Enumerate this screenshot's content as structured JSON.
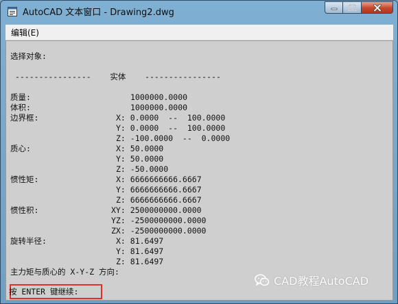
{
  "window": {
    "title": "AutoCAD 文本窗口 - Drawing2.dwg",
    "icons": {
      "app": "autocad-text-window-icon",
      "minimize": "minimize-icon",
      "maximize": "maximize-icon",
      "close": "close-icon"
    }
  },
  "menubar": {
    "edit_label": "编辑(E)"
  },
  "output": {
    "select_objects": "选择对象:",
    "section_header": " ----------------    实体    ----------------",
    "mass_label": "质量:",
    "mass_value": "1000000.0000",
    "volume_label": "体积:",
    "volume_value": "1000000.0000",
    "bbox_label": "边界框:",
    "bbox_x": "X: 0.0000  --  100.0000",
    "bbox_y": "Y: 0.0000  --  100.0000",
    "bbox_z": "Z: -100.0000  --  0.0000",
    "centroid_label": "质心:",
    "centroid_x": "X: 50.0000",
    "centroid_y": "Y: 50.0000",
    "centroid_z": "Z: -50.0000",
    "moments_label": "惯性矩:",
    "moments_x": "X: 6666666666.6667",
    "moments_y": "Y: 6666666666.6667",
    "moments_z": "Z: 6666666666.6667",
    "products_label": "惯性积:",
    "products_xy": "XY: 2500000000.0000",
    "products_yz": "YZ: -2500000000.0000",
    "products_zx": "ZX: -2500000000.0000",
    "gyration_label": "旋转半径:",
    "gyration_x": "X: 81.6497",
    "gyration_y": "Y: 81.6497",
    "gyration_z": "Z: 81.6497",
    "principal_line": "主力矩与质心的 X-Y-Z 方向:",
    "prompt": "按 ENTER 键继续:"
  },
  "watermark": {
    "text": "CAD教程AutoCAD",
    "icon": "wechat-logo-icon"
  },
  "colors": {
    "titlebar": "#7fb0d3",
    "text_bg": "#cfcfcf",
    "prompt_highlight": "#e0302a",
    "close_button": "#c4472a"
  }
}
